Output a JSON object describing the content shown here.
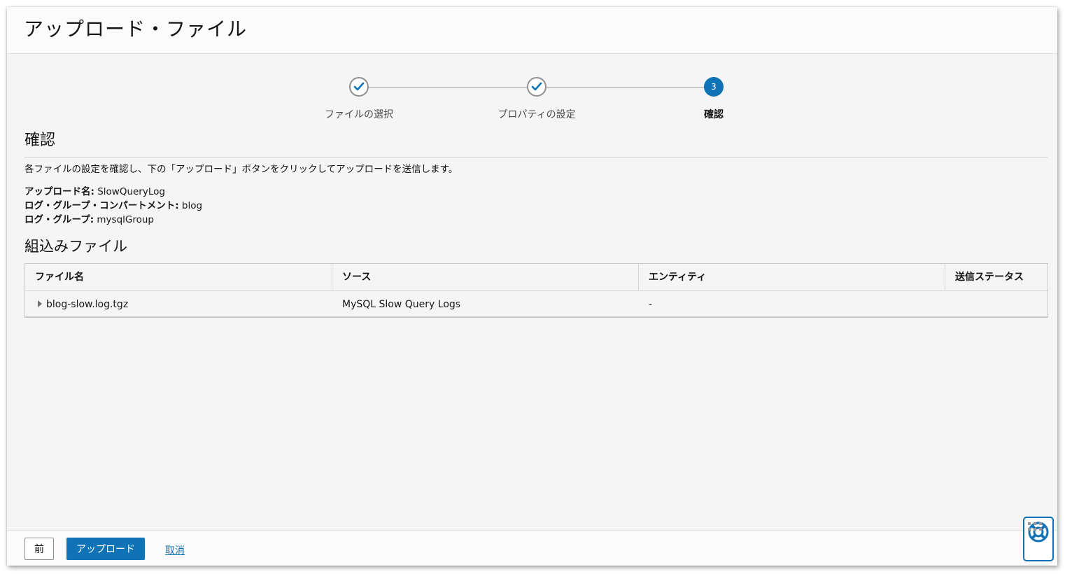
{
  "header": {
    "title": "アップロード・ファイル"
  },
  "train": {
    "steps": [
      {
        "label": "ファイルの選択",
        "state": "done"
      },
      {
        "label": "プロパティの設定",
        "state": "done"
      },
      {
        "label": "確認",
        "state": "current",
        "number": "3"
      }
    ]
  },
  "review": {
    "title": "確認",
    "description": "各ファイルの設定を確認し、下の「アップロード」ボタンをクリックしてアップロードを送信します。",
    "fields": [
      {
        "label": "アップロード名:",
        "value": "SlowQueryLog"
      },
      {
        "label": "ログ・グループ・コンパートメント:",
        "value": "blog"
      },
      {
        "label": "ログ・グループ:",
        "value": "mysqlGroup"
      }
    ]
  },
  "files": {
    "title": "組込みファイル",
    "columns": [
      "ファイル名",
      "ソース",
      "エンティティ",
      "送信ステータス"
    ],
    "rows": [
      {
        "file": "blog-slow.log.tgz",
        "source": "MySQL Slow Query Logs",
        "entity": "-",
        "status": ""
      }
    ]
  },
  "footer": {
    "prev_label": "前",
    "upload_label": "アップロード",
    "cancel_label": "取消"
  },
  "colors": {
    "accent": "#0f73b6"
  },
  "icons": {
    "step_done": "check-icon",
    "help": "lifebuoy-icon",
    "drag": "grip-icon"
  }
}
